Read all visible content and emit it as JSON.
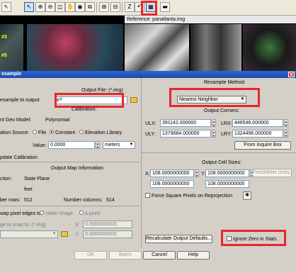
{
  "toolbar": {
    "icons": [
      "select-arrow-icon",
      "zoom-in-icon",
      "zoom-out-icon",
      "fit-icon",
      "pan-icon",
      "info-icon",
      "link-icon",
      "compare-icon",
      "swipe-icon",
      "z-icon",
      "undo-icon",
      "georef-icon",
      "ruler-icon"
    ]
  },
  "strip": {
    "reference_label": "Reference: panatlanta.img",
    "ids": [
      "#3",
      "#5"
    ]
  },
  "dialog": {
    "title": "esample",
    "left": {
      "resample_label": "esample to output",
      "output_file_label": "Output File: (*.img)",
      "output_file_value": "e?",
      "calibration_label": "Calibration:",
      "geo_model_label": "nt Geo Model:",
      "geo_model_value": "Polynomial",
      "source_label": "ation Source:",
      "source_file": "File",
      "source_constant": "Constant",
      "source_elev": "Elevation Library",
      "value_label": "Value:",
      "value_input": "0.0000",
      "units": "meters",
      "update_label": "pdate Calibration",
      "map_info_label": "Output Map Information:",
      "projection_label": "ction:",
      "projection_value": "State Plane",
      "units_value": "feet",
      "rows_label": "ber rows:",
      "rows_value": "512",
      "cols_label": "Number columns:",
      "cols_value": "514",
      "snap_label": "wap pixel edges to",
      "snap_raster": "raster image",
      "snap_point": "a point",
      "snap_to_label": "ge to snap to: (*.img)",
      "snap_x": "0.0000000000",
      "snap_y": "0.0000000000"
    },
    "right": {
      "method_label": "Resample Method:",
      "method_value": "Nearest Neighbor",
      "corners_label": "Output Corners:",
      "ulx_label": "ULX:",
      "ulx_value": "391142.000000",
      "lrx_label": "LRX:",
      "lrx_value": "446546.000000",
      "uly_label": "ULY:",
      "uly_value": "1379684.000000",
      "lry_label": "LRY:",
      "lry_value": "1324496.000000",
      "inquire_label": "From Inquire Box",
      "cell_label": "Output Cell Sizes:",
      "cx_label": "X:",
      "cx_value": "108.0000000000",
      "cy_label": "Y:",
      "cy_value": "108.0000000000",
      "feet_units": "Feet/Meter Units...",
      "cx2_value": "108.0000000000",
      "cy2_value": "108.0000000000",
      "force_label": "Force Square Pixels on Reprojection",
      "recalc_label": "Recalculate Output Defaults...",
      "ignore_label": "Ignore Zero in Stats."
    },
    "buttons": {
      "ok": "OK",
      "batch": "Batch",
      "cancel": "Cancel",
      "help": "Help"
    }
  },
  "colors": {
    "highlight": "#e8262e",
    "titlebar": "#2b66d4",
    "dialog_bg": "#d4d0c8"
  }
}
